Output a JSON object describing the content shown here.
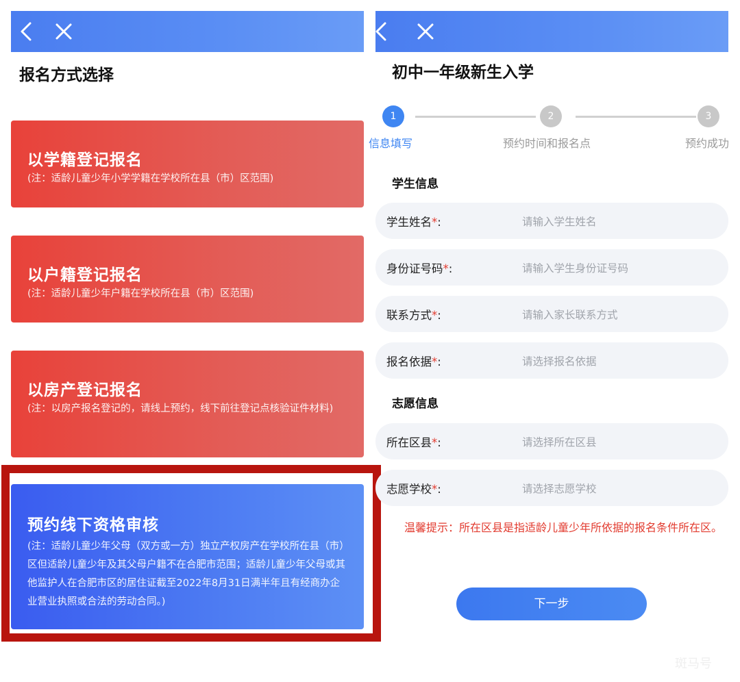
{
  "left": {
    "nav": {
      "back_icon": "chevron-left-icon",
      "close_icon": "close-icon"
    },
    "title": "报名方式选择",
    "options": [
      {
        "title": "以学籍登记报名",
        "note": "(注：适龄儿童少年小学学籍在学校所在县（市）区范围)"
      },
      {
        "title": "以户籍登记报名",
        "note": "(注：适龄儿童少年户籍在学校所在县（市）区范围)"
      },
      {
        "title": "以房产登记报名",
        "note": "(注：以房产报名登记的，请线上预约，线下前往登记点核验证件材料)"
      },
      {
        "title": "预约线下资格审核",
        "note": "(注：适龄儿童少年父母（双方或一方）独立产权房产在学校所在县（市）区但适龄儿童少年及其父母户籍不在合肥市范围；适龄儿童少年父母或其他监护人在合肥市区的居住证截至2022年8月31日满半年且有经商办企业营业执照或合法的劳动合同。)"
      }
    ],
    "colors": {
      "option_red": "#e8423a",
      "option_blue": "#3a5cf0",
      "highlight": "#b8150e"
    }
  },
  "right": {
    "nav": {
      "back_icon": "chevron-left-icon",
      "close_icon": "close-icon"
    },
    "title": "初中一年级新生入学",
    "steps": [
      {
        "num": "1",
        "label": "信息填写",
        "active": true
      },
      {
        "num": "2",
        "label": "预约时间和报名点",
        "active": false
      },
      {
        "num": "3",
        "label": "预约成功",
        "active": false
      }
    ],
    "sections": {
      "student": "学生信息",
      "preference": "志愿信息"
    },
    "fields": [
      {
        "label": "学生姓名",
        "required": "*",
        "colon": ":",
        "placeholder": "请输入学生姓名"
      },
      {
        "label": "身份证号码",
        "required": "*",
        "colon": ":",
        "placeholder": "请输入学生身份证号码"
      },
      {
        "label": "联系方式",
        "required": "*",
        "colon": ":",
        "placeholder": "请输入家长联系方式"
      },
      {
        "label": "报名依据",
        "required": "*",
        "colon": ":",
        "placeholder": "请选择报名依据"
      },
      {
        "label": "所在区县",
        "required": "*",
        "colon": ":",
        "placeholder": "请选择所在区县"
      },
      {
        "label": "志愿学校",
        "required": "*",
        "colon": ":",
        "placeholder": "请选择志愿学校"
      }
    ],
    "tip": "温馨提示：所在区县是指适龄儿童少年所依据的报名条件所在区。",
    "next_button": "下一步",
    "colors": {
      "accent": "#3f86f2",
      "required": "#e23b2f"
    }
  },
  "watermark": "斑马号"
}
